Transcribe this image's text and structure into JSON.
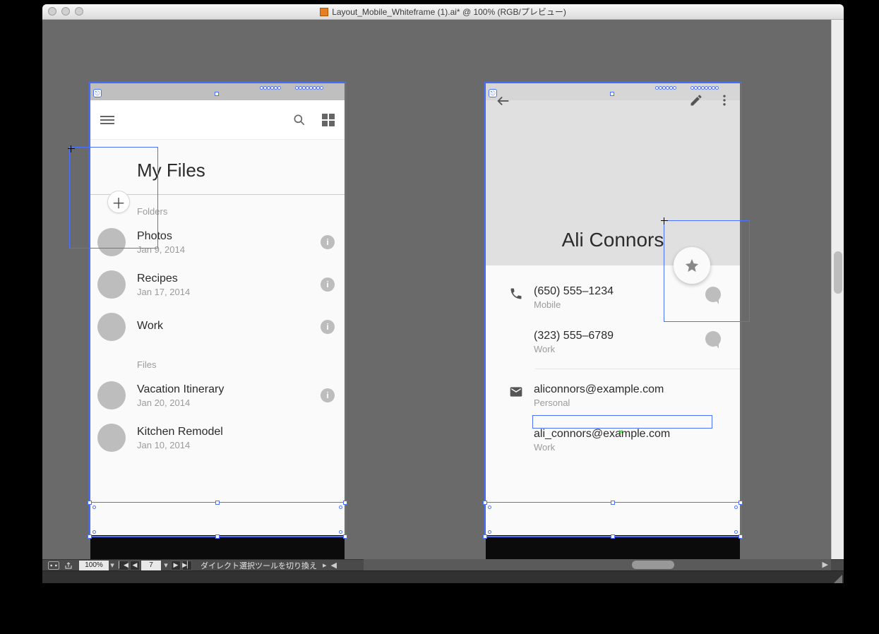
{
  "window": {
    "title": "Layout_Mobile_Whiteframe (1).ai* @ 100% (RGB/プレビュー)"
  },
  "status": {
    "zoom": "100%",
    "artboard_nav": "7",
    "tool_hint": "ダイレクト選択ツールを切り換え"
  },
  "artboard_files": {
    "title": "My Files",
    "section_folders": "Folders",
    "section_files": "Files",
    "folders": [
      {
        "name": "Photos",
        "date": "Jan 9, 2014"
      },
      {
        "name": "Recipes",
        "date": "Jan 17, 2014"
      },
      {
        "name": "Work",
        "date": ""
      }
    ],
    "files": [
      {
        "name": "Vacation Itinerary",
        "date": "Jan 20, 2014"
      },
      {
        "name": "Kitchen Remodel",
        "date": "Jan 10, 2014"
      }
    ]
  },
  "artboard_contact": {
    "name": "Ali Connors",
    "phones": [
      {
        "number": "(650) 555–1234",
        "label": "Mobile"
      },
      {
        "number": "(323) 555–6789",
        "label": "Work"
      }
    ],
    "emails": [
      {
        "address": "aliconnors@example.com",
        "label": "Personal"
      },
      {
        "address": "ali_connors@example.com",
        "label": "Work"
      }
    ]
  }
}
